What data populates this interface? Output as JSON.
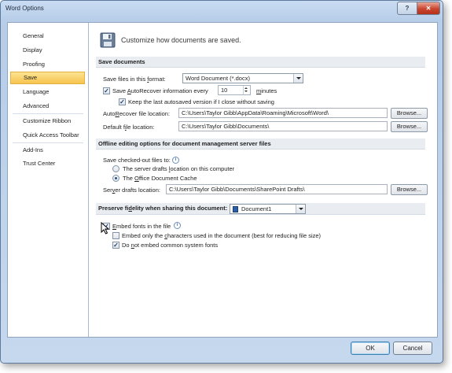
{
  "window": {
    "title": "Word Options",
    "help_glyph": "?",
    "close_glyph": "✕"
  },
  "sidebar": {
    "items": [
      {
        "label": "General"
      },
      {
        "label": "Display"
      },
      {
        "label": "Proofing"
      },
      {
        "label": "Save",
        "selected": true
      },
      {
        "label": "Language"
      },
      {
        "label": "Advanced"
      },
      {
        "label": "Customize Ribbon"
      },
      {
        "label": "Quick Access Toolbar"
      },
      {
        "label": "Add-Ins"
      },
      {
        "label": "Trust Center"
      }
    ]
  },
  "header": {
    "icon": "save-disk-icon",
    "text": "Customize how documents are saved."
  },
  "save_documents": {
    "title": "Save documents",
    "format_label_pre": "Save files in this ",
    "format_label_key": "f",
    "format_label_post": "ormat:",
    "format_value": "Word Document (*.docx)",
    "autorecover_pre": "Save ",
    "autorecover_key": "A",
    "autorecover_post": "utoRecover information every",
    "autorecover_checked": true,
    "autorecover_minutes": "10",
    "minutes_key": "m",
    "minutes_post": "inutes",
    "keep_last_label": "Keep the last autosaved version if I close without saving",
    "keep_last_checked": true,
    "autorecover_location_pre": "Auto",
    "autorecover_location_key": "R",
    "autorecover_location_post": "ecover file location:",
    "autorecover_location_value": "C:\\Users\\Taylor Gibb\\AppData\\Roaming\\Microsoft\\Word\\",
    "default_location_pre": "Default f",
    "default_location_key": "i",
    "default_location_post": "le location:",
    "default_location_value": "C:\\Users\\Taylor Gibb\\Documents\\",
    "browse_label": "Browse..."
  },
  "offline": {
    "title": "Offline editing options for document management server files",
    "checked_out_label": "Save checked-out files to:",
    "option1_pre": "The server drafts ",
    "option1_key": "l",
    "option1_post": "ocation on this computer",
    "option1_selected": false,
    "option2_pre": "The ",
    "option2_key": "O",
    "option2_post": "ffice Document Cache",
    "option2_selected": true,
    "server_drafts_pre": "Ser",
    "server_drafts_key": "v",
    "server_drafts_post": "er drafts location:",
    "server_drafts_value": "C:\\Users\\Taylor Gibb\\Documents\\SharePoint Drafts\\",
    "browse_label": "Browse..."
  },
  "fidelity": {
    "title_pre": "Preserve fi",
    "title_key": "d",
    "title_post": "elity when sharing this document:",
    "document_value": "Document1",
    "embed_pre": "",
    "embed_key": "E",
    "embed_post": "mbed fonts in the file",
    "embed_checked": true,
    "embed_only_pre": "Embed only the ",
    "embed_only_key": "c",
    "embed_only_post": "haracters used in the document (best for reducing file size)",
    "embed_only_checked": false,
    "no_common_pre": "Do ",
    "no_common_key": "n",
    "no_common_post": "ot embed common system fonts",
    "no_common_checked": true
  },
  "footer": {
    "ok_label": "OK",
    "cancel_label": "Cancel"
  },
  "glyphs": {
    "check": "✓",
    "info": "i"
  }
}
